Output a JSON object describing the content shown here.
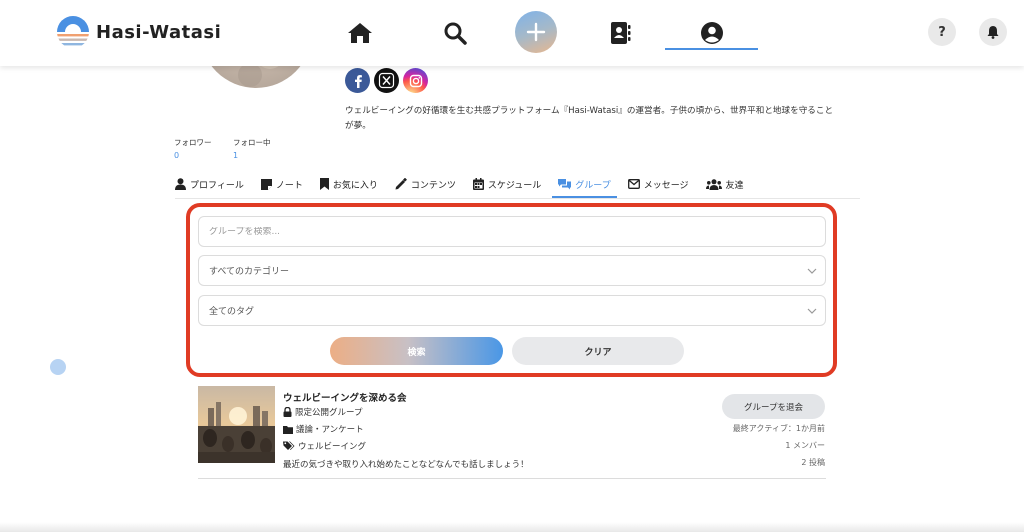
{
  "header": {
    "logo_text": "Hasi-Watasi",
    "help_label": "?"
  },
  "profile": {
    "bio": "ウェルビーイングの好循環を生む共感プラットフォーム『Hasi-Watasi』の運営者。子供の頃から、世界平和と地球を守ることが夢。",
    "followers_label": "フォロワー",
    "followers_count": "0",
    "following_label": "フォロー中",
    "following_count": "1"
  },
  "tabs": [
    {
      "label": "プロフィール",
      "icon": "user-icon"
    },
    {
      "label": "ノート",
      "icon": "note-icon"
    },
    {
      "label": "お気に入り",
      "icon": "bookmark-icon"
    },
    {
      "label": "コンテンツ",
      "icon": "pencil-icon"
    },
    {
      "label": "スケジュール",
      "icon": "calendar-icon"
    },
    {
      "label": "グループ",
      "icon": "chat-icon",
      "active": true
    },
    {
      "label": "メッセージ",
      "icon": "envelope-icon"
    },
    {
      "label": "友達",
      "icon": "users-icon"
    }
  ],
  "search": {
    "placeholder": "グループを検索...",
    "category_value": "すべてのカテゴリー",
    "tag_value": "全てのタグ",
    "search_label": "検索",
    "clear_label": "クリア"
  },
  "group": {
    "title": "ウェルビーイングを深める会",
    "visibility": "限定公開グループ",
    "category": "議論・アンケート",
    "tag": "ウェルビーイング",
    "description": "最近の気づきや取り入れ始めたことなどなんでも話しましょう！",
    "leave_label": "グループを退会",
    "last_active": "最終アクティブ：1か月前",
    "members": "1 メンバー",
    "posts": "2 投稿"
  },
  "colors": {
    "accent": "#4a90e2",
    "highlight_border": "#e03b24"
  }
}
